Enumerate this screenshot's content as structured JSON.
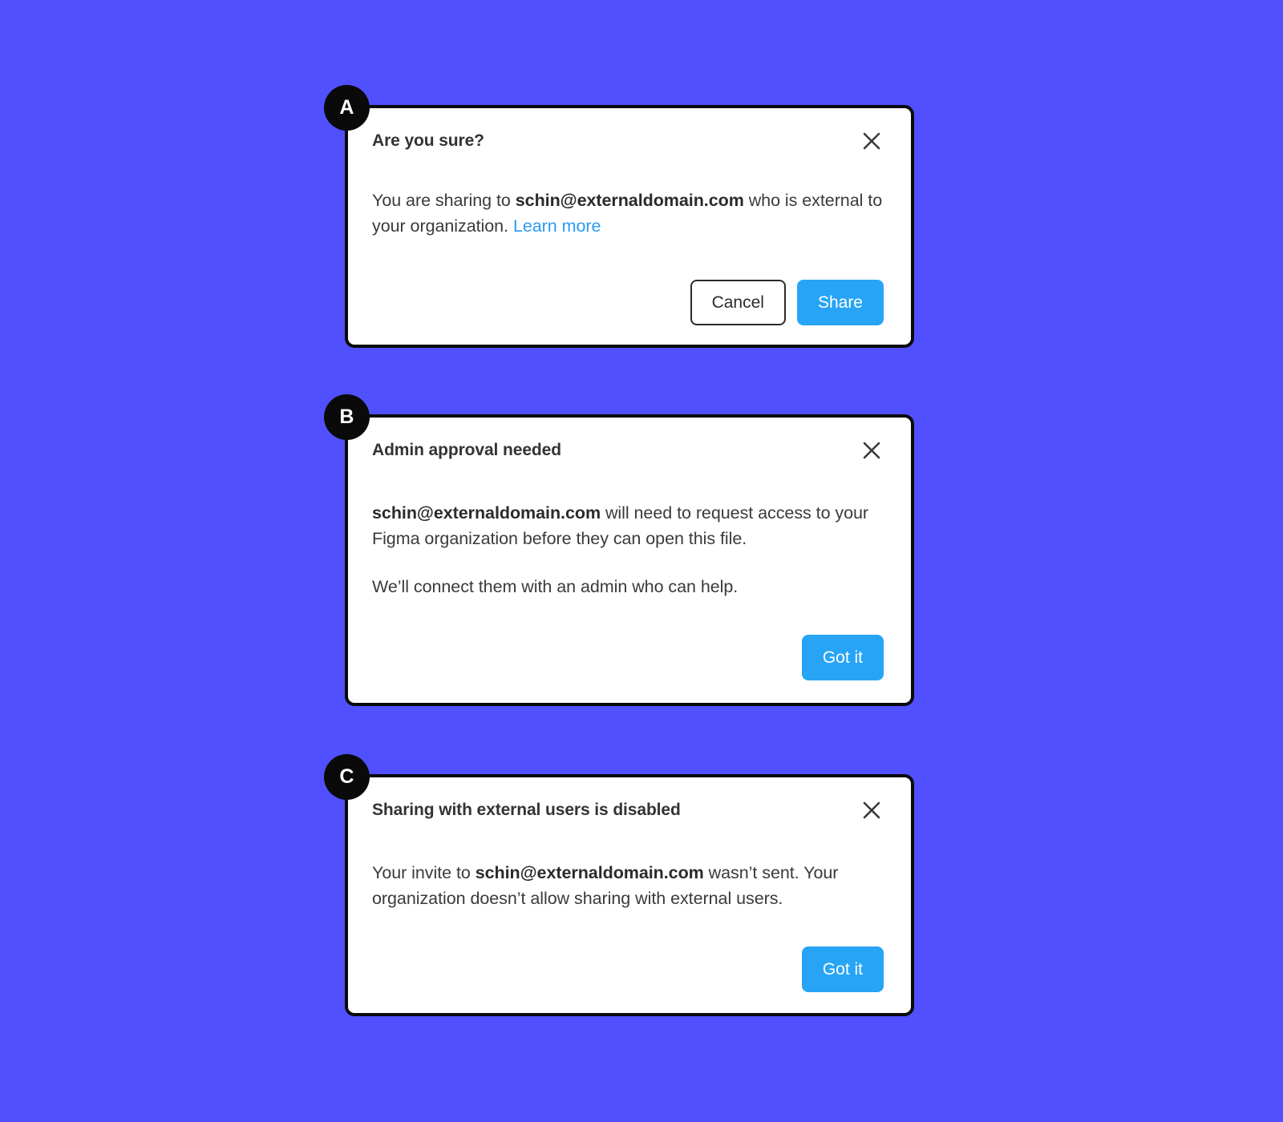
{
  "canvas": {
    "background_color": "#5050FF",
    "accent_color": "#27A4F5",
    "link_color": "#2B9BF4",
    "badge_color": "#0A0A0A"
  },
  "cards": [
    {
      "badge": "A",
      "title": "Are you sure?",
      "close_icon": "close-icon",
      "paragraphs": [
        [
          {
            "type": "text",
            "value": "You are sharing to "
          },
          {
            "type": "bold",
            "value": "schin@externaldomain.com"
          },
          {
            "type": "text",
            "value": " who is external to your organization. "
          },
          {
            "type": "link",
            "value": "Learn more"
          }
        ]
      ],
      "buttons": [
        {
          "label": "Cancel",
          "style": "secondary"
        },
        {
          "label": "Share",
          "style": "primary"
        }
      ]
    },
    {
      "badge": "B",
      "title": "Admin approval needed",
      "close_icon": "close-icon",
      "paragraphs": [
        [
          {
            "type": "bold",
            "value": "schin@externaldomain.com"
          },
          {
            "type": "text",
            "value": " will need to request access to your Figma organization before they can open this file."
          }
        ],
        [
          {
            "type": "text",
            "value": "We’ll connect them with an admin who can help."
          }
        ]
      ],
      "buttons": [
        {
          "label": "Got it",
          "style": "primary"
        }
      ]
    },
    {
      "badge": "C",
      "title": "Sharing with external users is disabled",
      "close_icon": "close-icon",
      "paragraphs": [
        [
          {
            "type": "text",
            "value": "Your invite to "
          },
          {
            "type": "bold",
            "value": "schin@externaldomain.com"
          },
          {
            "type": "text",
            "value": " wasn’t sent. Your organization doesn’t allow sharing with external users."
          }
        ]
      ],
      "buttons": [
        {
          "label": "Got it",
          "style": "primary"
        }
      ]
    }
  ]
}
